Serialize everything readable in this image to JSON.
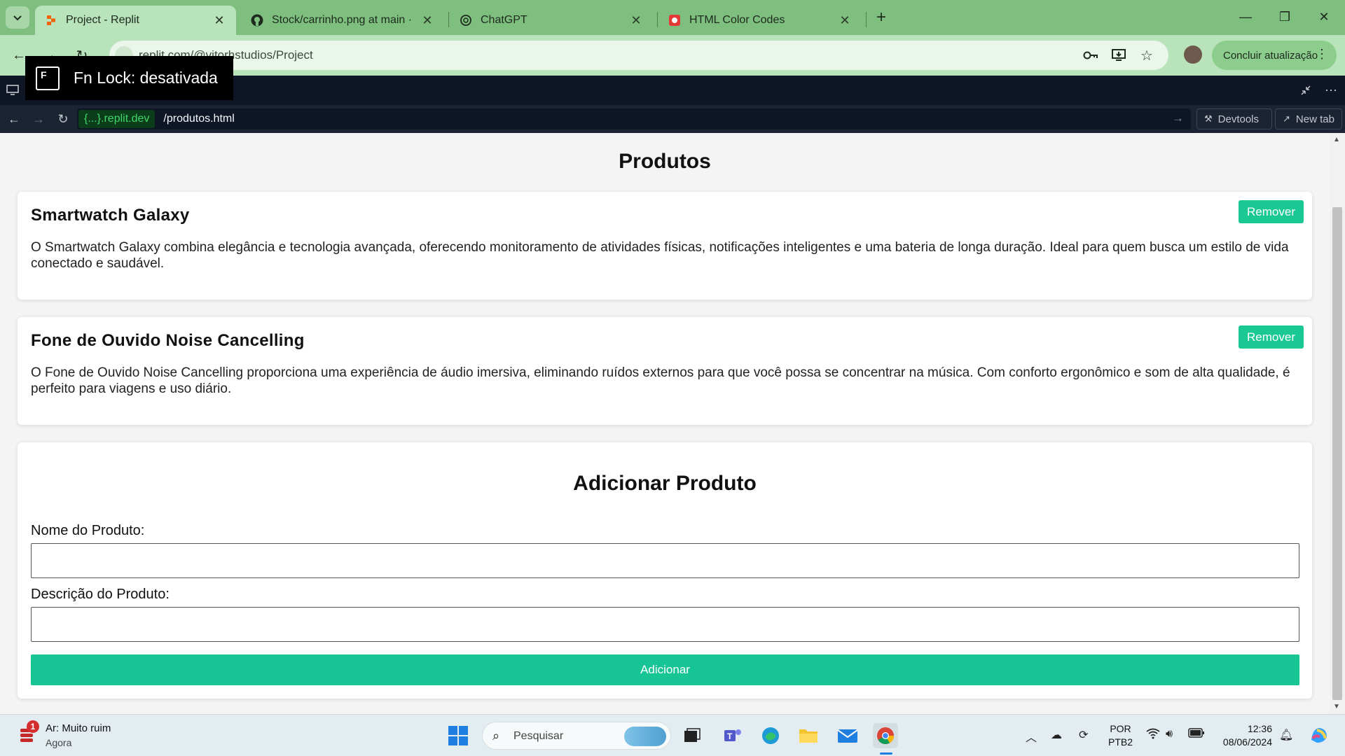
{
  "browser": {
    "tabs": [
      {
        "title": "Project - Replit",
        "active": true,
        "icon": "replit-icon"
      },
      {
        "title": "Stock/carrinho.png at main · vr",
        "active": false,
        "icon": "github-icon"
      },
      {
        "title": "ChatGPT",
        "active": false,
        "icon": "chatgpt-icon"
      },
      {
        "title": "HTML Color Codes",
        "active": false,
        "icon": "color-codes-icon"
      }
    ],
    "address": "replit.com/@vitorhstudios/Project",
    "update_label": "Concluir atualização",
    "theme_color": "#7ebf7f"
  },
  "toast": {
    "icon_letter": "F",
    "text": "Fn Lock: desativada"
  },
  "webview": {
    "domain": "{...}.replit.dev",
    "path": "/produtos.html",
    "devtools_label": "Devtools",
    "newtab_label": "New tab"
  },
  "page": {
    "title": "Produtos",
    "products": [
      {
        "name": "Smartwatch Galaxy",
        "description": "O Smartwatch Galaxy combina elegância e tecnologia avançada, oferecendo monitoramento de atividades físicas, notificações inteligentes e uma bateria de longa duração. Ideal para quem busca um estilo de vida conectado e saudável.",
        "remove_label": "Remover"
      },
      {
        "name": "Fone de Ouvido Noise Cancelling",
        "description": "O Fone de Ouvido Noise Cancelling proporciona uma experiência de áudio imersiva, eliminando ruídos externos para que você possa se concentrar na música. Com conforto ergonômico e som de alta qualidade, é perfeito para viagens e uso diário.",
        "remove_label": "Remover"
      }
    ],
    "form": {
      "title": "Adicionar Produto",
      "name_label": "Nome do Produto:",
      "name_value": "",
      "description_label": "Descrição do Produto:",
      "description_value": "",
      "submit_label": "Adicionar"
    },
    "accent_color": "#1ac894"
  },
  "taskbar": {
    "weather_badge": "1",
    "weather_title": "Ar: Muito ruim",
    "weather_sub": "Agora",
    "search_placeholder": "Pesquisar",
    "lang_line1": "POR",
    "lang_line2": "PTB2",
    "time": "12:36",
    "date": "08/06/2024"
  }
}
